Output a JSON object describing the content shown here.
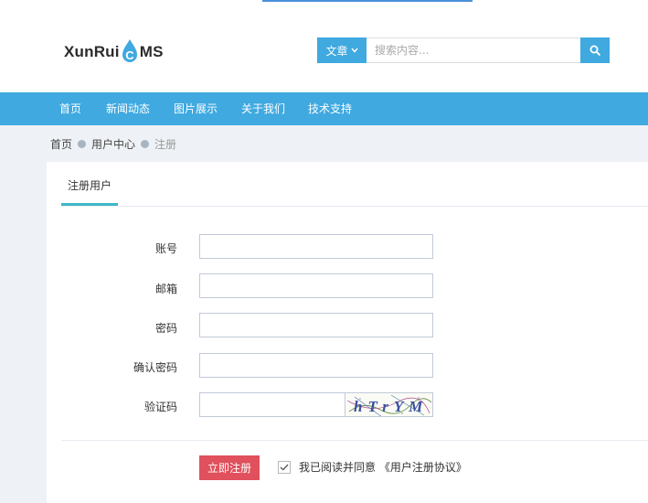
{
  "logo": {
    "text_before": "XunRui",
    "text_after": "MS",
    "drop_letter": "C",
    "brand_color": "#3fa9e0"
  },
  "search": {
    "type_label": "文章",
    "type_icon": "chevron-down-icon",
    "placeholder": "搜索内容...",
    "button_icon": "search-icon"
  },
  "nav": {
    "items": [
      "首页",
      "新闻动态",
      "图片展示",
      "关于我们",
      "技术支持"
    ]
  },
  "breadcrumb": {
    "items": [
      "首页",
      "用户中心",
      "注册"
    ]
  },
  "tab": {
    "label": "注册用户"
  },
  "form": {
    "account_label": "账号",
    "email_label": "邮箱",
    "password_label": "密码",
    "confirm_label": "确认密码",
    "captcha_label": "验证码",
    "captcha_text": "hTrYM"
  },
  "submit": {
    "label": "立即注册",
    "color": "#e0505d"
  },
  "agreement": {
    "text": "我已阅读并同意 《用户注册协议》",
    "checked": true
  },
  "colors": {
    "accent": "#3fa9e0",
    "tab_underline": "#3fb8c6",
    "page_bg": "#eef1f5"
  }
}
